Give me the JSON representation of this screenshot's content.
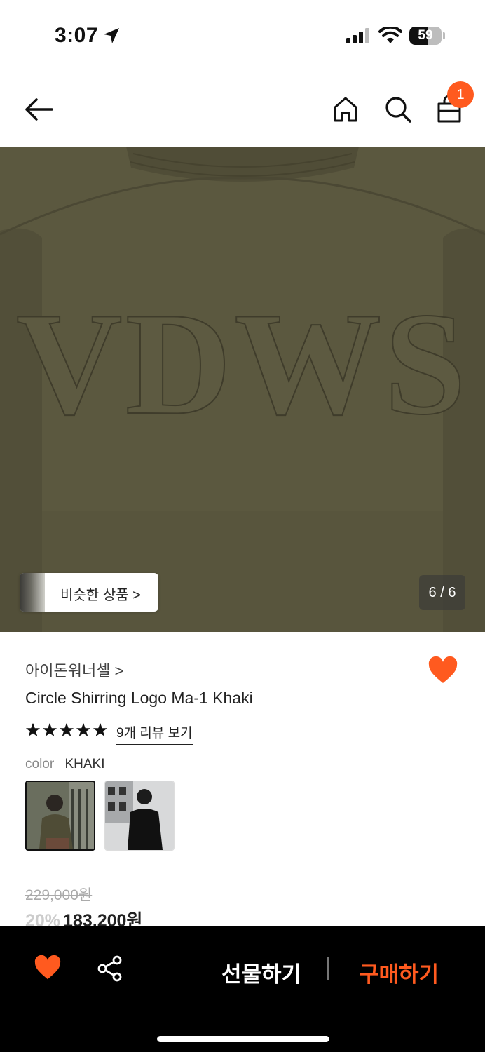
{
  "status_bar": {
    "time": "3:07",
    "battery": "59",
    "battery_level_pct": 59
  },
  "nav": {
    "cart_badge": "1",
    "accent_color": "#ff5a1f"
  },
  "hero": {
    "embroidered_text": "VDWS",
    "similar_products_label": "비슷한 상품 >",
    "image_counter": "6 / 6"
  },
  "product": {
    "brand": "아이돈워너셀 >",
    "name": "Circle Shirring Logo Ma-1 Khaki",
    "rating_stars": 5,
    "reviews_link": "9개 리뷰 보기",
    "color_label": "color",
    "color_value": "KHAKI",
    "original_price": "229,000원",
    "discount": "20%",
    "sale_price": "183,200원"
  },
  "bottom_bar": {
    "gift_label": "선물하기",
    "buy_label": "구매하기"
  }
}
